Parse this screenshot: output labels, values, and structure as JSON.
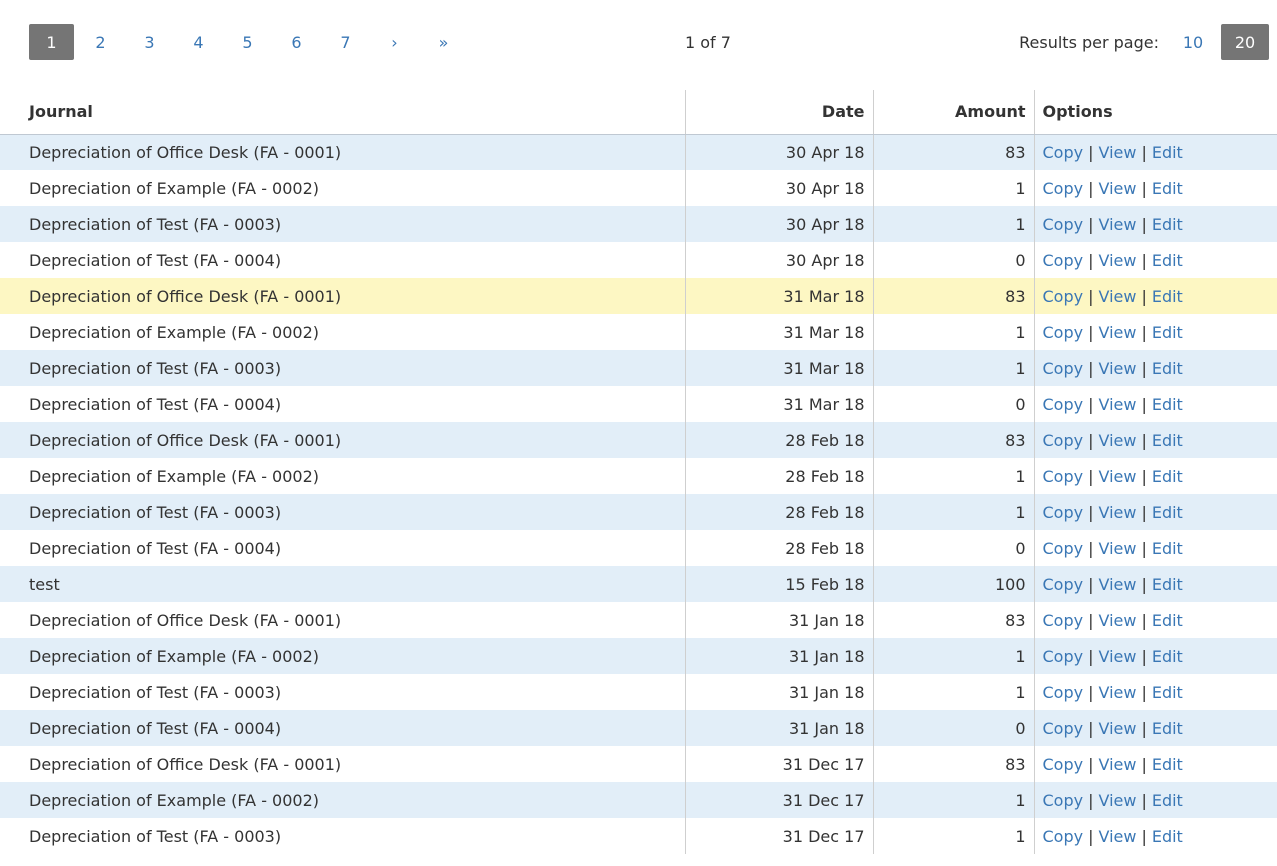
{
  "pagination": {
    "pages": [
      "1",
      "2",
      "3",
      "4",
      "5",
      "6",
      "7"
    ],
    "current_page": "1",
    "next_label": "›",
    "last_label": "»",
    "page_status": "1 of 7"
  },
  "results_per_page": {
    "label": "Results per page:",
    "options": [
      "10",
      "20"
    ],
    "selected": "20"
  },
  "table": {
    "columns": {
      "journal": "Journal",
      "date": "Date",
      "amount": "Amount",
      "options": "Options"
    },
    "option_labels": {
      "copy": "Copy",
      "view": "View",
      "edit": "Edit",
      "separator": "|"
    },
    "highlighted_row_index": 4,
    "rows": [
      {
        "journal": "Depreciation of Office Desk (FA - 0001)",
        "date": "30 Apr 18",
        "amount": "83"
      },
      {
        "journal": "Depreciation of Example (FA - 0002)",
        "date": "30 Apr 18",
        "amount": "1"
      },
      {
        "journal": "Depreciation of Test (FA - 0003)",
        "date": "30 Apr 18",
        "amount": "1"
      },
      {
        "journal": "Depreciation of Test (FA - 0004)",
        "date": "30 Apr 18",
        "amount": "0"
      },
      {
        "journal": "Depreciation of Office Desk (FA - 0001)",
        "date": "31 Mar 18",
        "amount": "83"
      },
      {
        "journal": "Depreciation of Example (FA - 0002)",
        "date": "31 Mar 18",
        "amount": "1"
      },
      {
        "journal": "Depreciation of Test (FA - 0003)",
        "date": "31 Mar 18",
        "amount": "1"
      },
      {
        "journal": "Depreciation of Test (FA - 0004)",
        "date": "31 Mar 18",
        "amount": "0"
      },
      {
        "journal": "Depreciation of Office Desk (FA - 0001)",
        "date": "28 Feb 18",
        "amount": "83"
      },
      {
        "journal": "Depreciation of Example (FA - 0002)",
        "date": "28 Feb 18",
        "amount": "1"
      },
      {
        "journal": "Depreciation of Test (FA - 0003)",
        "date": "28 Feb 18",
        "amount": "1"
      },
      {
        "journal": "Depreciation of Test (FA - 0004)",
        "date": "28 Feb 18",
        "amount": "0"
      },
      {
        "journal": "test",
        "date": "15 Feb 18",
        "amount": "100"
      },
      {
        "journal": "Depreciation of Office Desk (FA - 0001)",
        "date": "31 Jan 18",
        "amount": "83"
      },
      {
        "journal": "Depreciation of Example (FA - 0002)",
        "date": "31 Jan 18",
        "amount": "1"
      },
      {
        "journal": "Depreciation of Test (FA - 0003)",
        "date": "31 Jan 18",
        "amount": "1"
      },
      {
        "journal": "Depreciation of Test (FA - 0004)",
        "date": "31 Jan 18",
        "amount": "0"
      },
      {
        "journal": "Depreciation of Office Desk (FA - 0001)",
        "date": "31 Dec 17",
        "amount": "83"
      },
      {
        "journal": "Depreciation of Example (FA - 0002)",
        "date": "31 Dec 17",
        "amount": "1"
      },
      {
        "journal": "Depreciation of Test (FA - 0003)",
        "date": "31 Dec 17",
        "amount": "1"
      }
    ]
  }
}
